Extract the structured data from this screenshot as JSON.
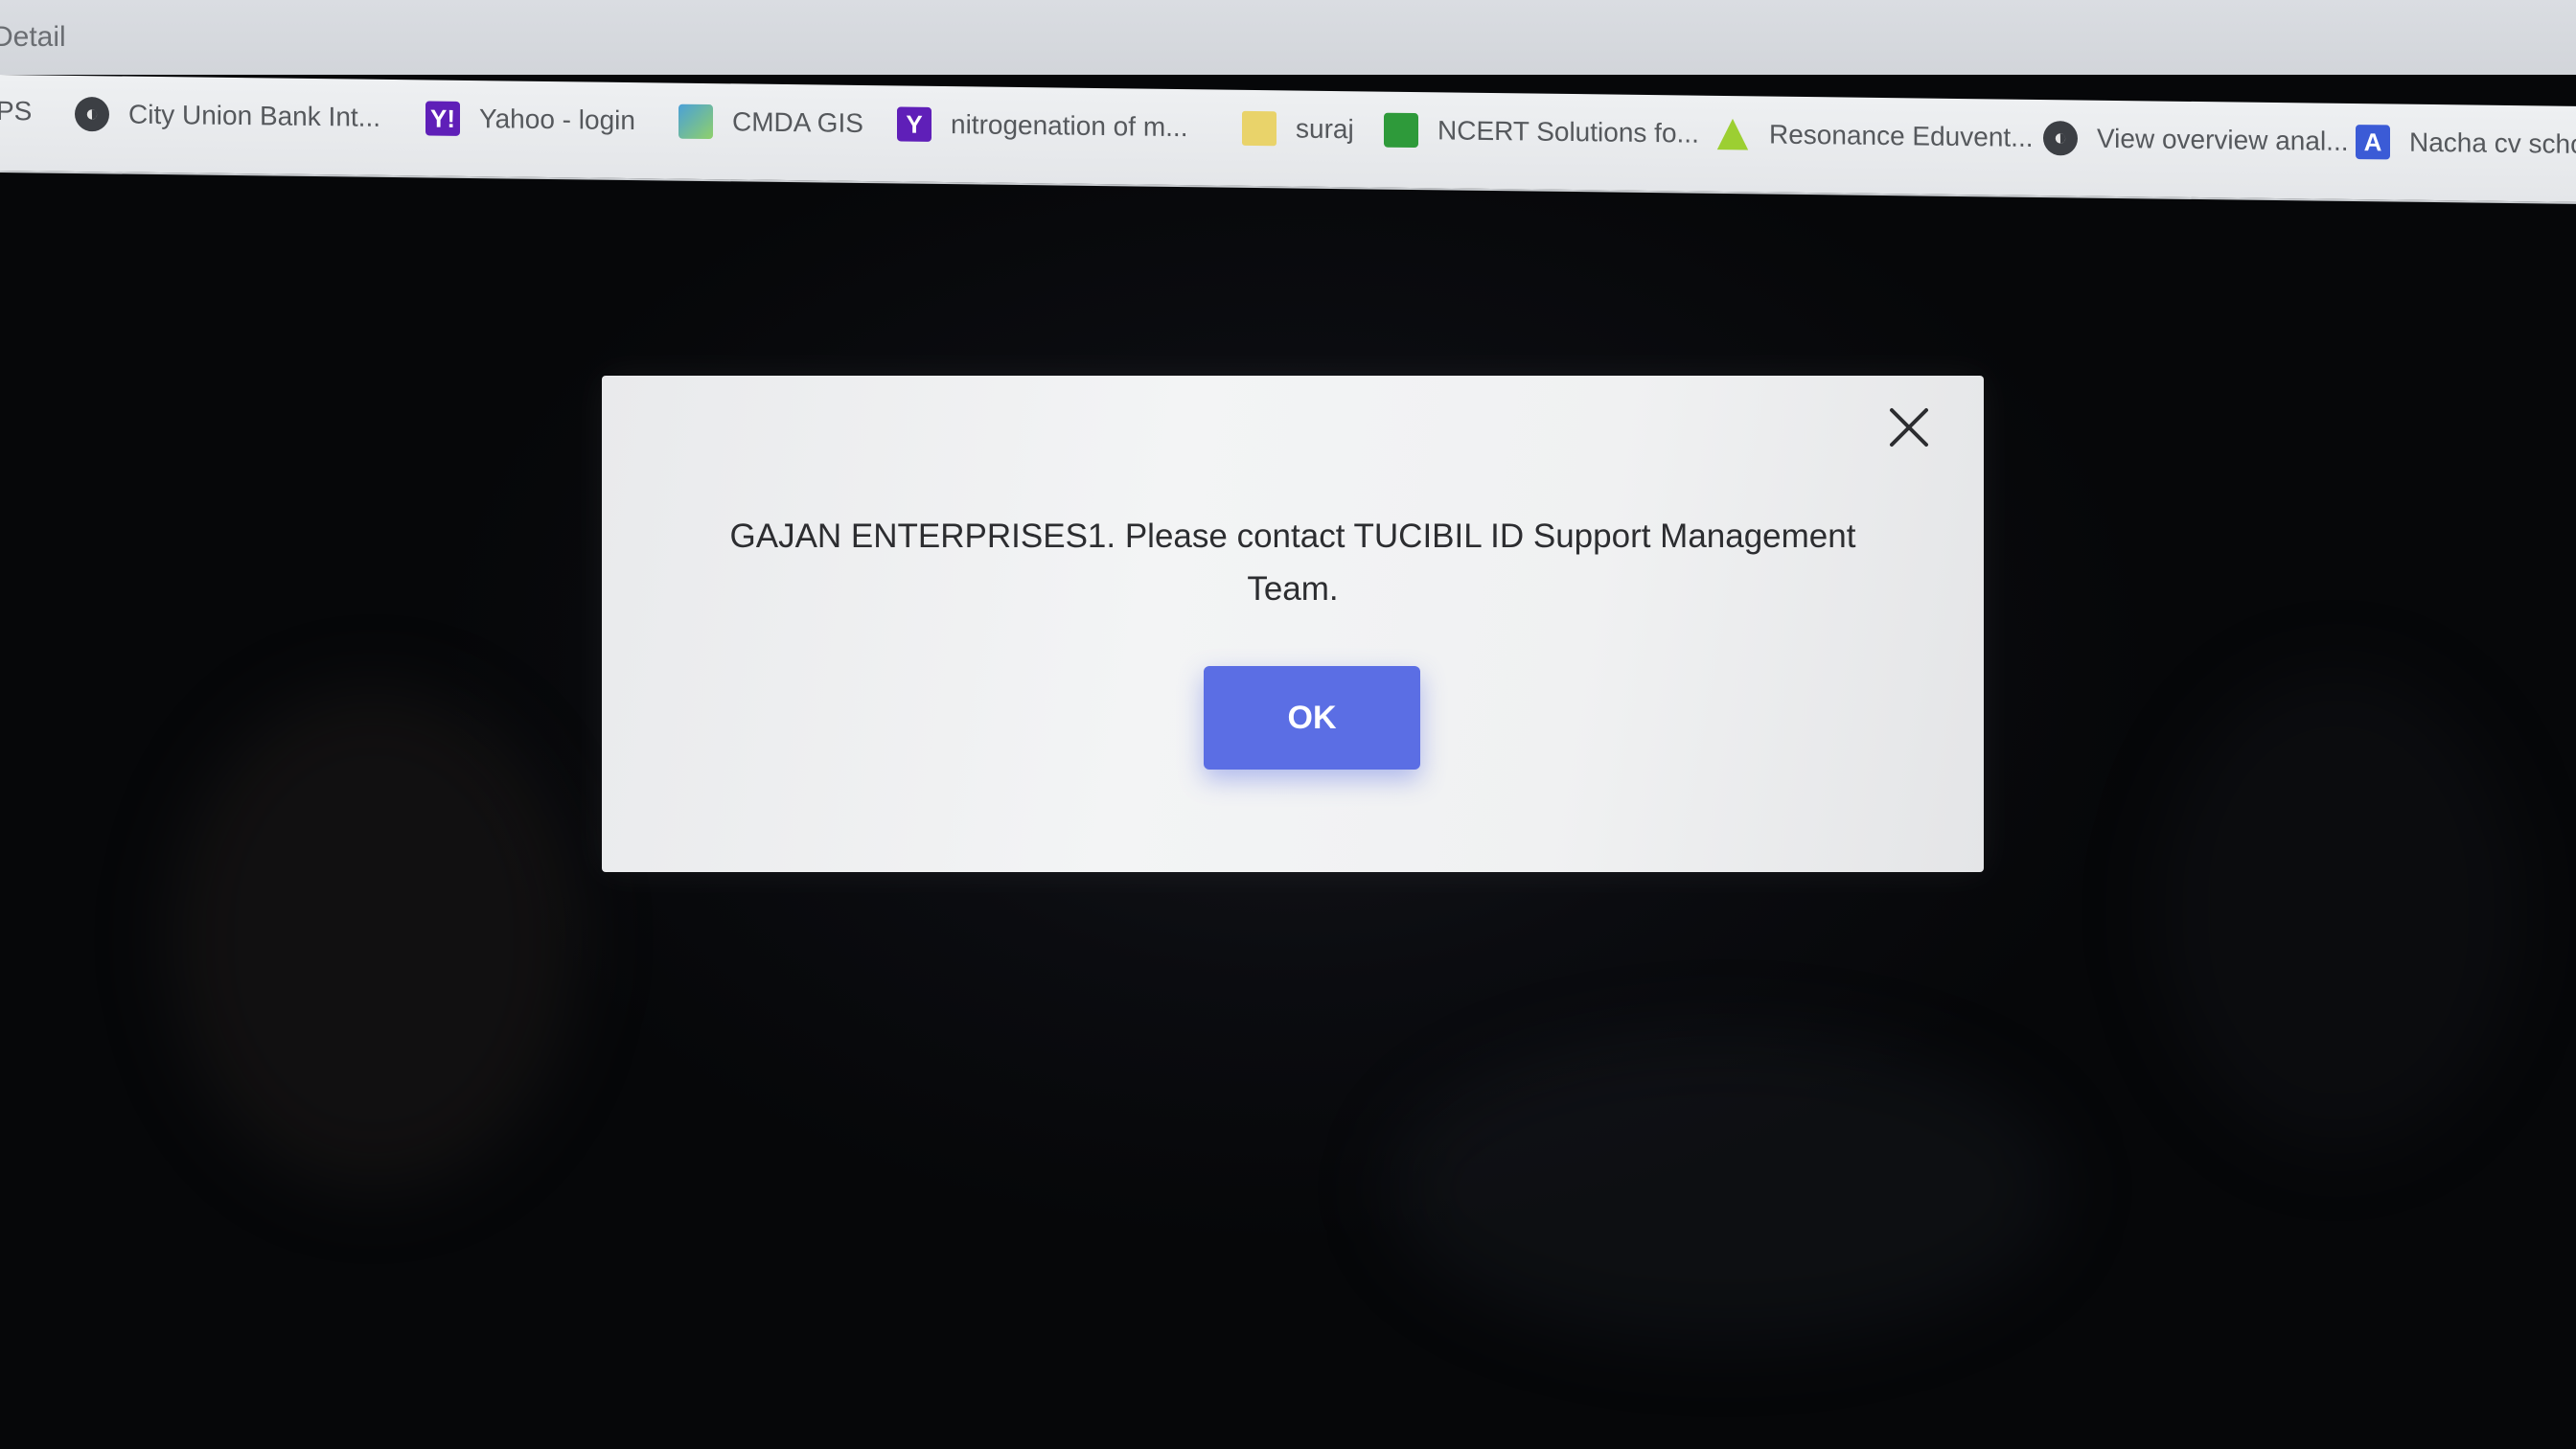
{
  "browser": {
    "tab_title": "Detail",
    "bookmarks": [
      {
        "label": "PS",
        "icon": "app-icon"
      },
      {
        "label": "City Union Bank Int...",
        "icon": "globe-icon"
      },
      {
        "label": "Yahoo - login",
        "icon": "yahoo-icon",
        "glyph": "Y!"
      },
      {
        "label": "CMDA GIS",
        "icon": "cmda-icon"
      },
      {
        "label": "nitrogenation of m...",
        "icon": "yahoo-icon",
        "glyph": "Y"
      },
      {
        "label": "suraj",
        "icon": "folder-icon"
      },
      {
        "label": "NCERT Solutions fo...",
        "icon": "ncert-icon"
      },
      {
        "label": "Resonance Eduvent...",
        "icon": "resonance-icon"
      },
      {
        "label": "View overview anal...",
        "icon": "globe-icon"
      },
      {
        "label": "Nacha cv school",
        "icon": "nacha-icon",
        "glyph": "A"
      }
    ]
  },
  "dialog": {
    "message_line1": "GAJAN ENTERPRISES1. Please contact TUCIBIL ID Support Management",
    "message_line2": "Team.",
    "ok_label": "OK"
  },
  "colors": {
    "ok_button": "#5b6ee4",
    "dialog_bg": "#f0f1f2",
    "backdrop": "#07080b"
  }
}
